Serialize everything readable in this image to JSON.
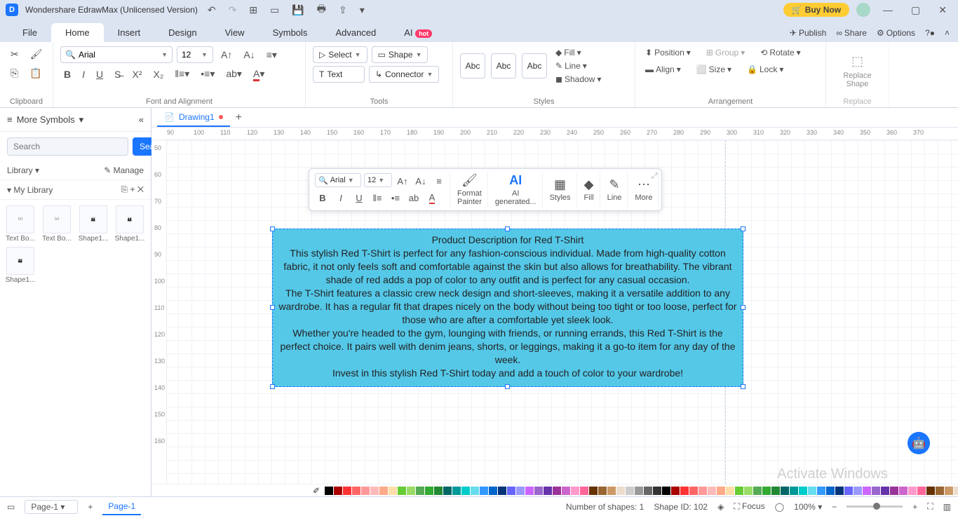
{
  "title_bar": {
    "app_name": "Wondershare EdrawMax (Unlicensed Version)",
    "buy_now": "Buy Now"
  },
  "menu": {
    "items": [
      "File",
      "Home",
      "Insert",
      "Design",
      "View",
      "Symbols",
      "Advanced"
    ],
    "ai": "AI",
    "hot": "hot",
    "publish": "Publish",
    "share": "Share",
    "options": "Options"
  },
  "ribbon": {
    "clipboard": "Clipboard",
    "font_align": "Font and Alignment",
    "tools": "Tools",
    "styles": "Styles",
    "arrangement": "Arrangement",
    "replace": "Replace",
    "font_name": "Arial",
    "font_size": "12",
    "select": "Select",
    "shape": "Shape",
    "text": "Text",
    "connector": "Connector",
    "abc": "Abc",
    "fill": "Fill",
    "line": "Line",
    "shadow": "Shadow",
    "position": "Position",
    "align": "Align",
    "group": "Group",
    "size": "Size",
    "rotate": "Rotate",
    "lock": "Lock",
    "replace_shape": "Replace\nShape"
  },
  "left_panel": {
    "more_symbols": "More Symbols",
    "search_ph": "Search",
    "search_btn": "Search",
    "library": "Library",
    "manage": "Manage",
    "my_library": "My Library",
    "items": [
      "Text Bo...",
      "Text Bo...",
      "Shape1...",
      "Shape1...",
      "Shape1..."
    ]
  },
  "doc": {
    "tab_name": "Drawing1"
  },
  "float_toolbar": {
    "font": "Arial",
    "size": "12",
    "format_painter": "Format\nPainter",
    "ai_gen": "AI\ngenerated...",
    "styles": "Styles",
    "fill": "Fill",
    "line_lbl": "Line",
    "more": "More"
  },
  "shape_text": {
    "title": "Product Description for Red T-Shirt",
    "p1": "This stylish Red T-Shirt is perfect for any fashion-conscious individual. Made from high-quality cotton fabric, it not only feels soft and comfortable against the skin but also allows for breathability. The vibrant shade of red adds a pop of color to any outfit and is perfect for any casual occasion.",
    "p2": "The T-Shirt features a classic crew neck design and short-sleeves, making it a versatile addition to any wardrobe. It has a regular fit that drapes nicely on the body without being too tight or too loose, perfect for those who are after a comfortable yet sleek look.",
    "p3": "Whether you're headed to the gym, lounging with friends, or running errands, this Red T-Shirt is the perfect choice. It pairs well with denim jeans, shorts, or leggings, making it a go-to item for any day of the week.",
    "p4": "Invest in this stylish Red T-Shirt today and add a touch of color to your wardrobe!"
  },
  "status": {
    "page_sel": "Page-1",
    "page_tab": "Page-1",
    "num_shapes": "Number of shapes: 1",
    "shape_id": "Shape ID: 102",
    "focus": "Focus",
    "zoom": "100%"
  },
  "watermark": {
    "l1": "Activate Windows"
  },
  "ruler_h": [
    "90",
    "100",
    "110",
    "120",
    "130",
    "140",
    "150",
    "160",
    "170",
    "180",
    "190",
    "200",
    "210",
    "220",
    "230",
    "240",
    "250",
    "260",
    "270",
    "280",
    "290",
    "300",
    "310",
    "320",
    "330",
    "340",
    "350",
    "360",
    "370"
  ],
  "ruler_v": [
    "50",
    "60",
    "70",
    "80",
    "90",
    "100",
    "110",
    "120",
    "130",
    "140",
    "150",
    "160"
  ],
  "colors": [
    "#000",
    "#a00",
    "#f33",
    "#f66",
    "#f99",
    "#fbb",
    "#fa8",
    "#fda",
    "#6c3",
    "#9d6",
    "#5a5",
    "#3a3",
    "#283",
    "#066",
    "#099",
    "#0cc",
    "#6de",
    "#39f",
    "#06c",
    "#037",
    "#66f",
    "#99f",
    "#c6f",
    "#96c",
    "#63a",
    "#939",
    "#c6c",
    "#f9c",
    "#f69",
    "#630",
    "#963",
    "#c96",
    "#edc",
    "#ccc",
    "#999",
    "#666",
    "#333"
  ]
}
